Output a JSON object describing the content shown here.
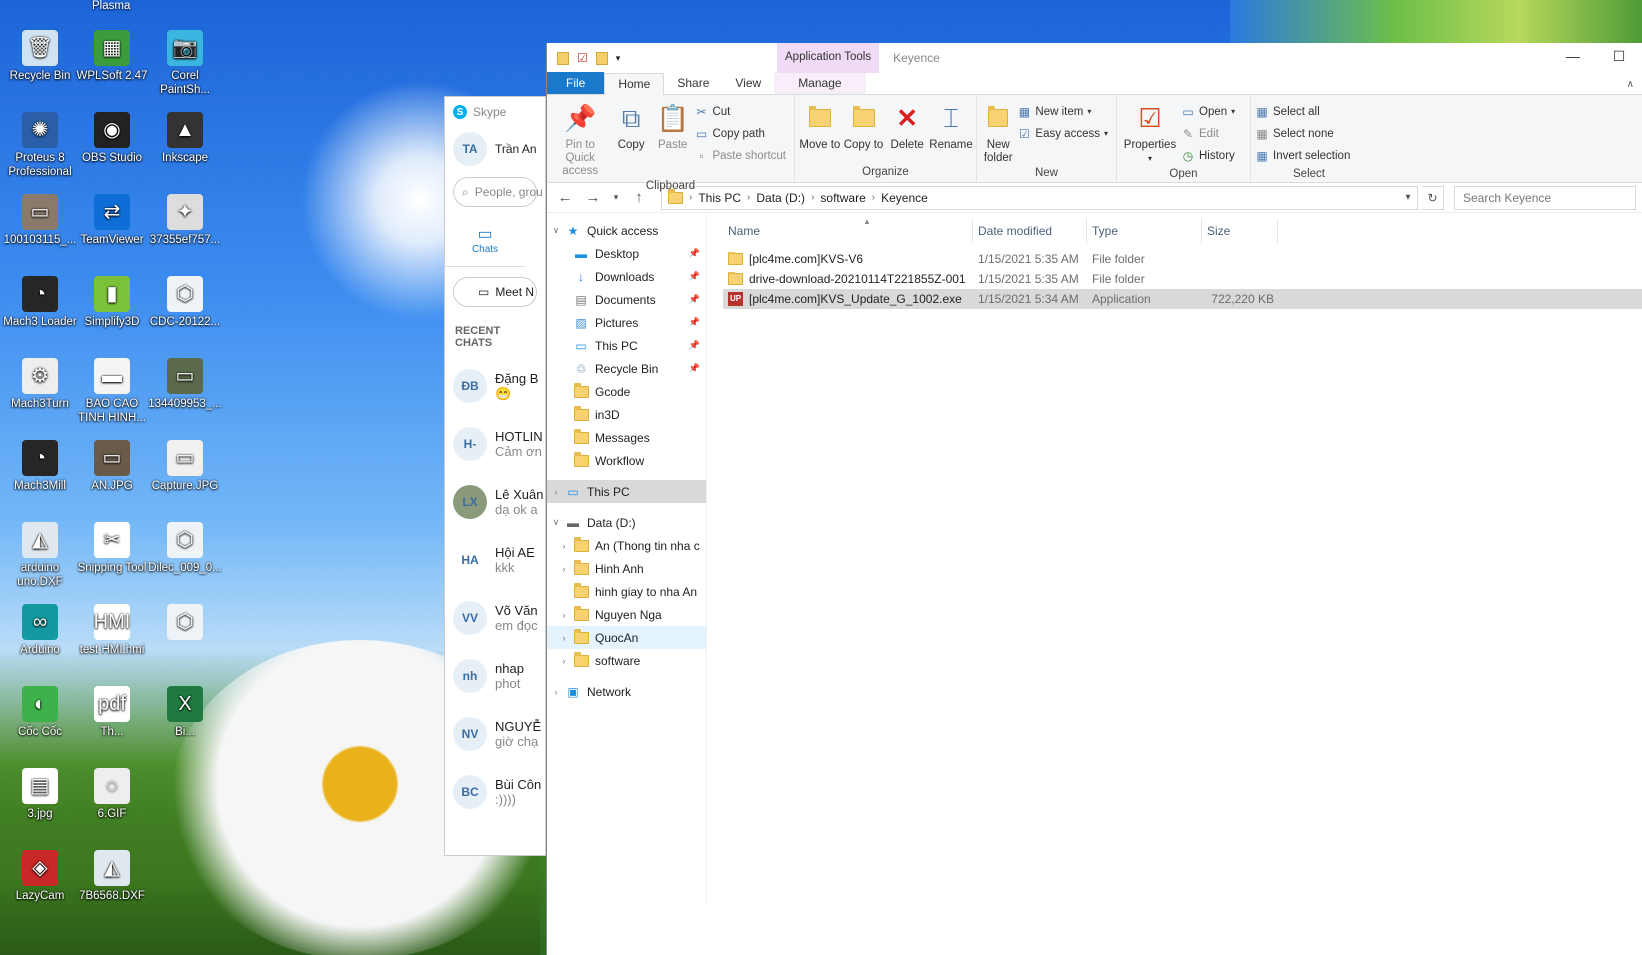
{
  "desktop": {
    "top_label": "Plasma",
    "icons": [
      {
        "label": "Recycle Bin",
        "glyph": "🗑",
        "bg": "#cfe3f5"
      },
      {
        "label": "WPLSoft 2.47",
        "glyph": "▦",
        "bg": "#3c9c3c"
      },
      {
        "label": "Corel PaintSh...",
        "glyph": "📷",
        "bg": "#3bb6e0"
      },
      {
        "label": "Proteus 8 Professional",
        "glyph": "✺",
        "bg": "#2a5ea8"
      },
      {
        "label": "OBS Studio",
        "glyph": "◉",
        "bg": "#222222"
      },
      {
        "label": "Inkscape",
        "glyph": "▲",
        "bg": "#333333"
      },
      {
        "label": "100103115_...",
        "glyph": "▭",
        "bg": "#8a7a6a"
      },
      {
        "label": "TeamViewer",
        "glyph": "⇄",
        "bg": "#0e6ed8"
      },
      {
        "label": "37355ef757...",
        "glyph": "✦",
        "bg": "#dddddd"
      },
      {
        "label": "Mach3 Loader",
        "glyph": "◔",
        "bg": "#262626"
      },
      {
        "label": "Simplify3D",
        "glyph": "▮",
        "bg": "#7cc13a"
      },
      {
        "label": "CDC-20122...",
        "glyph": "⬡",
        "bg": "#eef3f8"
      },
      {
        "label": "Mach3Turn",
        "glyph": "⚙",
        "bg": "#eeeeee"
      },
      {
        "label": "BAO CAO TINH HINH...",
        "glyph": "▬",
        "bg": "#f4f4f4"
      },
      {
        "label": "134409953_...",
        "glyph": "▭",
        "bg": "#5a6a4a"
      },
      {
        "label": "Mach3Mill",
        "glyph": "◔",
        "bg": "#262626"
      },
      {
        "label": "AN.JPG",
        "glyph": "▭",
        "bg": "#6a5a4a"
      },
      {
        "label": "Capture.JPG",
        "glyph": "▭",
        "bg": "#f0f0f0"
      },
      {
        "label": "arduino uno.DXF",
        "glyph": "◭",
        "bg": "#dfe8ef"
      },
      {
        "label": "Snipping Tool",
        "glyph": "✂",
        "bg": "#ffffff"
      },
      {
        "label": "Dilec_009_0...",
        "glyph": "⬡",
        "bg": "#eef3f8"
      },
      {
        "label": "Arduino",
        "glyph": "∞",
        "bg": "#139aa0"
      },
      {
        "label": "test HMI.hmi",
        "glyph": "HMI",
        "bg": "#ffffff"
      },
      {
        "label": "",
        "glyph": "⬡",
        "bg": "#eef3f8"
      },
      {
        "label": "Cốc Cốc",
        "glyph": "◐",
        "bg": "#3eb24a"
      },
      {
        "label": "Th...",
        "glyph": "pdf",
        "bg": "#ffffff"
      },
      {
        "label": "Bi...",
        "glyph": "X",
        "bg": "#1e7a3e"
      },
      {
        "label": "3.jpg",
        "glyph": "▤",
        "bg": "#ffffff"
      },
      {
        "label": "6.GIF",
        "glyph": "◌",
        "bg": "#eeeeee"
      },
      {
        "label": "",
        "glyph": "",
        "bg": "transparent"
      },
      {
        "label": "LazyCam",
        "glyph": "◈",
        "bg": "#c82828"
      },
      {
        "label": "7B6568.DXF",
        "glyph": "◭",
        "bg": "#dfe8ef"
      }
    ]
  },
  "skype": {
    "title": "Skype",
    "user_initials": "TA",
    "user_name": "Trần An",
    "search_placeholder": "People, grou",
    "chats_label": "Chats",
    "meet_label": "Meet N",
    "recent_label": "RECENT CHATS",
    "chats": [
      {
        "initials": "ĐB",
        "name": "Đặng B",
        "msg": "😁",
        "avbg": "#e6eef6"
      },
      {
        "initials": "H-",
        "name": "HOTLIN",
        "msg": "Cảm ơn",
        "avbg": "#e6eef6"
      },
      {
        "initials": "LX",
        "name": "Lê Xuân",
        "msg": "dạ ok a",
        "avbg": "#8a9a7a"
      },
      {
        "initials": "HA",
        "name": "Hội AE",
        "msg": "kkk",
        "avbg": "#ffffff"
      },
      {
        "initials": "VV",
        "name": "Võ Văn",
        "msg": "em đọc",
        "avbg": "#e6eef6"
      },
      {
        "initials": "nh",
        "name": "nhap",
        "msg": "phot",
        "avbg": "#e6eef6"
      },
      {
        "initials": "NV",
        "name": "NGUYỄ",
        "msg": "giờ chạ",
        "avbg": "#e6eef6"
      },
      {
        "initials": "BC",
        "name": "Bùi Côn",
        "msg": ":))))",
        "avbg": "#e6eef6"
      }
    ]
  },
  "explorer": {
    "app_tools": "Application Tools",
    "window_title": "Keyence",
    "tabs": {
      "file": "File",
      "home": "Home",
      "share": "Share",
      "view": "View",
      "manage": "Manage"
    },
    "ribbon": {
      "pin": "Pin to Quick access",
      "copy": "Copy",
      "paste": "Paste",
      "cut": "Cut",
      "copy_path": "Copy path",
      "paste_shortcut": "Paste shortcut",
      "clipboard": "Clipboard",
      "move_to": "Move to",
      "copy_to": "Copy to",
      "delete": "Delete",
      "rename": "Rename",
      "organize": "Organize",
      "new_folder": "New folder",
      "new_item": "New item",
      "easy_access": "Easy access",
      "new": "New",
      "properties": "Properties",
      "open": "Open",
      "edit": "Edit",
      "history": "History",
      "open_group": "Open",
      "select_all": "Select all",
      "select_none": "Select none",
      "invert_selection": "Invert selection",
      "select": "Select"
    },
    "address": [
      "This PC",
      "Data (D:)",
      "software",
      "Keyence"
    ],
    "search_placeholder": "Search Keyence",
    "nav": {
      "quick_access": "Quick access",
      "pinned": [
        {
          "label": "Desktop",
          "glyph": "▬",
          "color": "#1d8fe0"
        },
        {
          "label": "Downloads",
          "glyph": "↓",
          "color": "#1d6fe0"
        },
        {
          "label": "Documents",
          "glyph": "▤",
          "color": "#777"
        },
        {
          "label": "Pictures",
          "glyph": "▨",
          "color": "#3b8dd6"
        },
        {
          "label": "This PC",
          "glyph": "▭",
          "color": "#1d8fe0"
        },
        {
          "label": "Recycle Bin",
          "glyph": "♲",
          "color": "#4a78b0"
        }
      ],
      "folders": [
        "Gcode",
        "in3D",
        "Messages",
        "Workflow"
      ],
      "this_pc": "This PC",
      "data_drive": "Data (D:)",
      "drive_folders": [
        {
          "label": "An (Thong tin nha c",
          "expand": true
        },
        {
          "label": "Hinh Anh",
          "expand": true
        },
        {
          "label": "hinh giay to nha An",
          "expand": false
        },
        {
          "label": "Nguyen Nga",
          "expand": true
        },
        {
          "label": "QuocAn",
          "expand": true
        },
        {
          "label": "software",
          "expand": true
        }
      ],
      "network": "Network"
    },
    "columns": {
      "name": "Name",
      "date": "Date modified",
      "type": "Type",
      "size": "Size"
    },
    "files": [
      {
        "name": "[plc4me.com]KVS-V6",
        "date": "1/15/2021 5:35 AM",
        "type": "File folder",
        "size": "",
        "kind": "folder"
      },
      {
        "name": "drive-download-20210114T221855Z-001",
        "date": "1/15/2021 5:35 AM",
        "type": "File folder",
        "size": "",
        "kind": "folder"
      },
      {
        "name": "[plc4me.com]KVS_Update_G_1002.exe",
        "date": "1/15/2021 5:34 AM",
        "type": "Application",
        "size": "722,220 KB",
        "kind": "exe"
      }
    ]
  }
}
